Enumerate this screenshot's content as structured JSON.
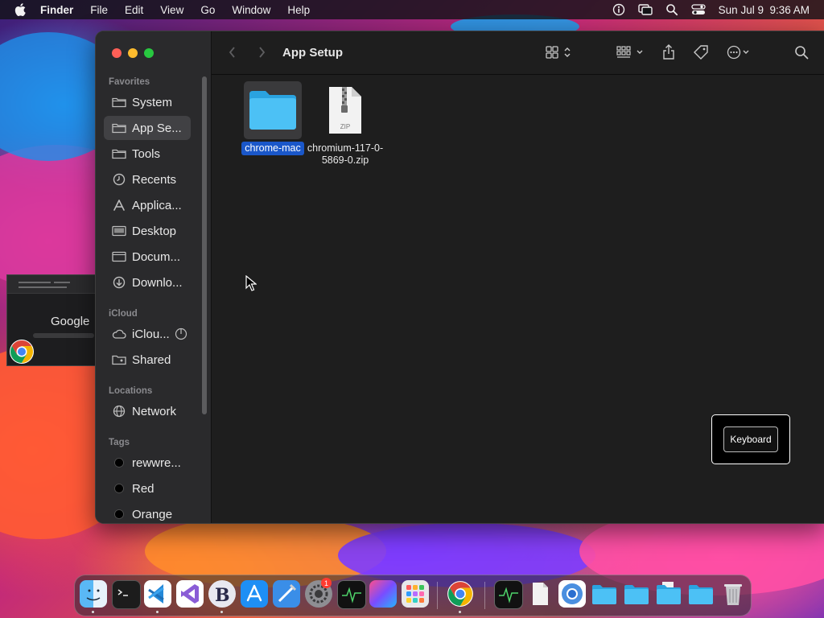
{
  "menubar": {
    "app": "Finder",
    "items": [
      "File",
      "Edit",
      "View",
      "Go",
      "Window",
      "Help"
    ],
    "datetime": "Sun Jul 9  9:36 AM"
  },
  "thumbnail": {
    "label": "Google"
  },
  "finder": {
    "title": "App Setup",
    "sidebar": {
      "favorites_label": "Favorites",
      "favorites": [
        {
          "label": "System",
          "icon": "folder-icon"
        },
        {
          "label": "App Se...",
          "icon": "folder-icon",
          "selected": true
        },
        {
          "label": "Tools",
          "icon": "folder-icon"
        },
        {
          "label": "Recents",
          "icon": "clock-icon"
        },
        {
          "label": "Applica...",
          "icon": "applications-icon"
        },
        {
          "label": "Desktop",
          "icon": "desktop-icon"
        },
        {
          "label": "Docum...",
          "icon": "document-icon"
        },
        {
          "label": "Downlo...",
          "icon": "download-icon"
        }
      ],
      "icloud_label": "iCloud",
      "icloud": [
        {
          "label": "iClou...",
          "icon": "cloud-icon"
        },
        {
          "label": "Shared",
          "icon": "shared-folder-icon"
        }
      ],
      "locations_label": "Locations",
      "locations": [
        {
          "label": "Network",
          "icon": "globe-icon"
        }
      ],
      "tags_label": "Tags",
      "tags": [
        {
          "label": "rewwre...",
          "color": "#000000"
        },
        {
          "label": "Red",
          "color": "#000000"
        },
        {
          "label": "Orange",
          "color": "#000000"
        }
      ]
    },
    "files": [
      {
        "name": "chrome-mac",
        "type": "folder",
        "selected": true
      },
      {
        "name_line1": "chromium-117-0-",
        "name_line2": "5869-0.zip",
        "type": "zip",
        "badge": "ZIP"
      }
    ]
  },
  "keyboard_popup": {
    "label": "Keyboard"
  },
  "dock": {
    "apps": [
      "finder",
      "terminal",
      "vscode",
      "visual-studio",
      "bbedit",
      "app-store",
      "xcode",
      "system-settings",
      "activity-monitor",
      "shortcuts",
      "launchpad",
      "chrome",
      "activity-monitor-2",
      "document",
      "chromium",
      "folder",
      "folder",
      "folder",
      "folder",
      "trash"
    ],
    "settings_badge": "1"
  },
  "colors": {
    "accent": "#1a57c9",
    "folder_blue": "#3fb6f0",
    "selection": "#414144"
  }
}
